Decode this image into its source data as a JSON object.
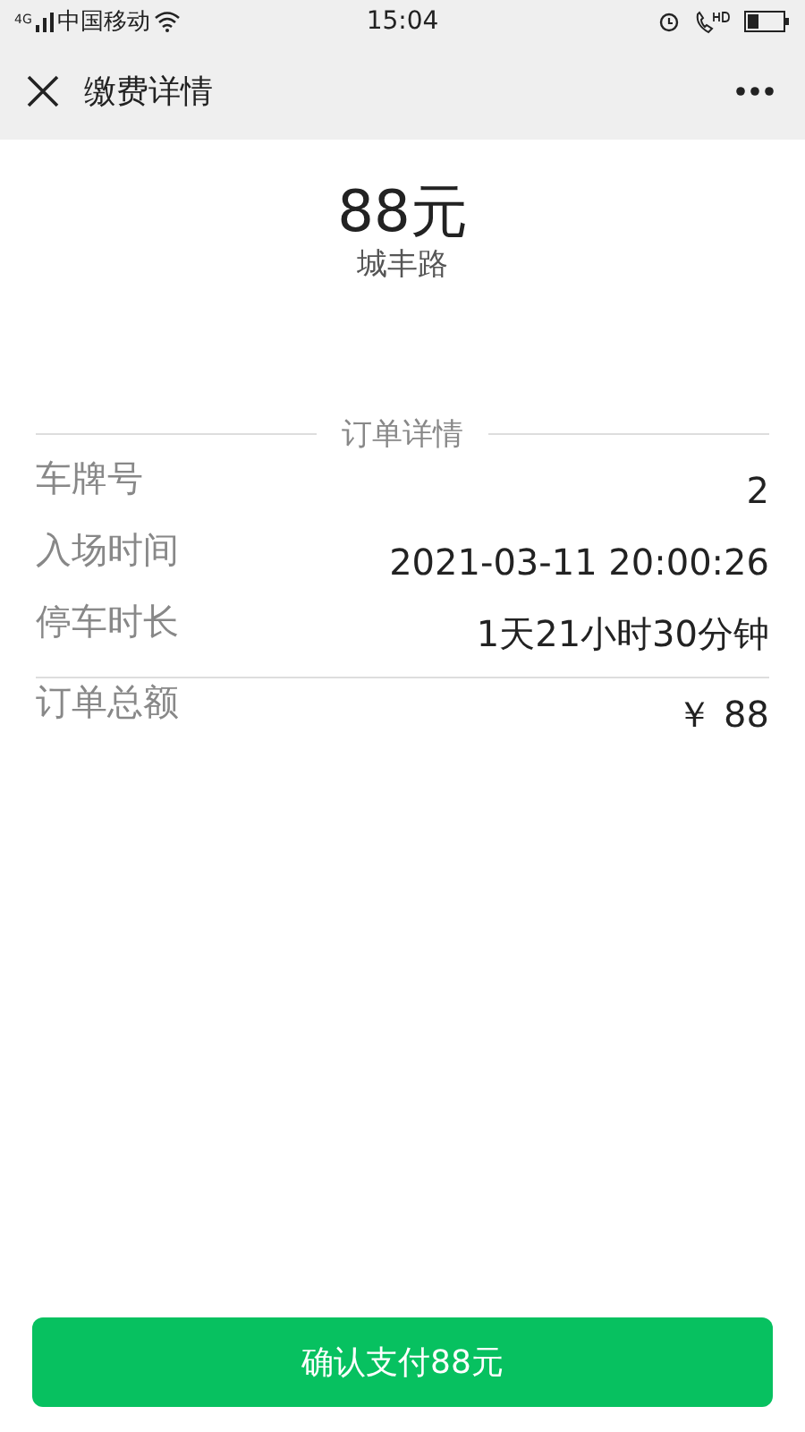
{
  "status_bar": {
    "carrier": "中国移动",
    "network": "4G",
    "time": "15:04"
  },
  "nav": {
    "title": "缴费详情"
  },
  "summary": {
    "amount": "88元",
    "location": "城丰路"
  },
  "section_title": "订单详情",
  "rows": [
    {
      "label": "车牌号",
      "value": "2"
    },
    {
      "label": "入场时间",
      "value": "2021-03-11 20:00:26"
    },
    {
      "label": "停车时长",
      "value": "1天21小时30分钟"
    }
  ],
  "total": {
    "label": "订单总额",
    "value": "￥ 88"
  },
  "pay_button": "确认支付88元"
}
